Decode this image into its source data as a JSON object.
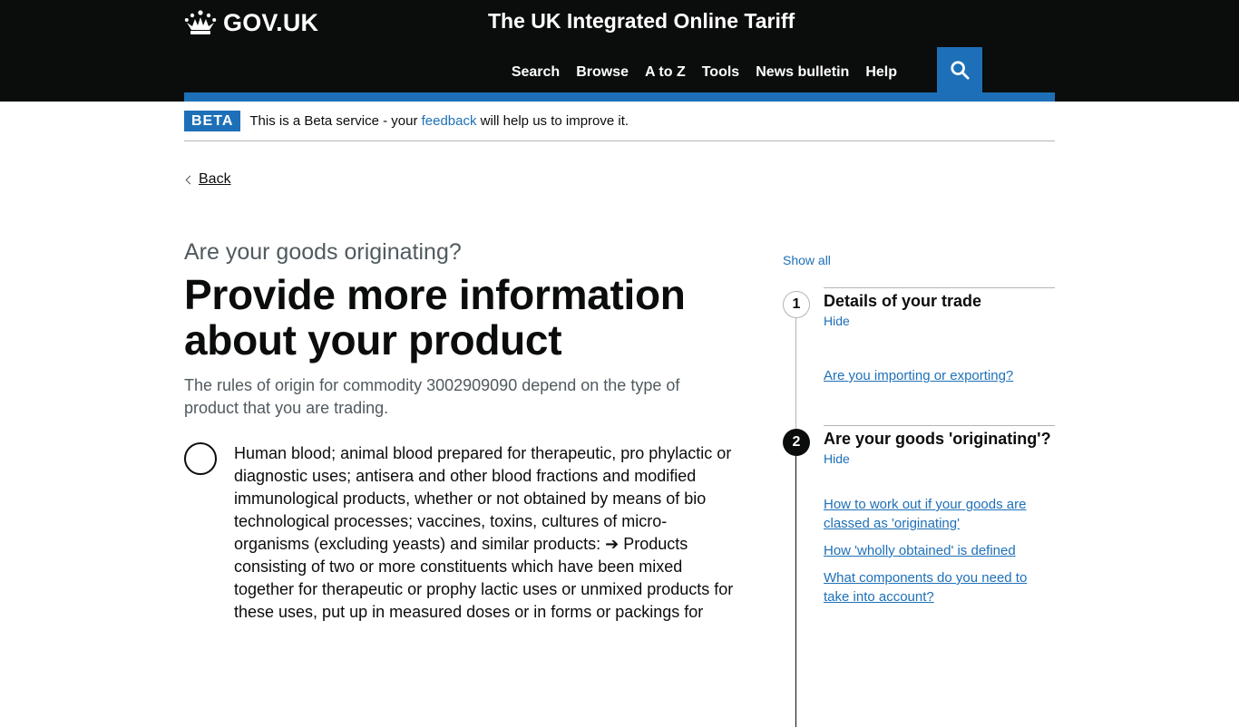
{
  "header": {
    "logo_text": "GOV.UK",
    "service_name": "The UK Integrated Online Tariff",
    "nav": [
      "Search",
      "Browse",
      "A to Z",
      "Tools",
      "News bulletin",
      "Help"
    ]
  },
  "phase_banner": {
    "tag": "BETA",
    "text_before": "This is a Beta service - your ",
    "link": "feedback",
    "text_after": " will help us to improve it."
  },
  "back_link": "Back",
  "main": {
    "caption": "Are your goods originating?",
    "heading": "Provide more information about your product",
    "lead": "The rules of origin for commodity 3002909090 depend on the type of product that you are trading.",
    "options": [
      "Human blood; animal blood prepared for therapeutic, pro phylactic or diagnostic uses; antisera and other blood fractions and modified immunological products, whether or not obtained by means of bio technological processes; vaccines, toxins, cultures of micro-organisms (excluding yeasts) and similar products: ➔ Products consisting of two or more constituents which have been mixed together for therapeutic or prophy lactic uses or unmixed products for these uses, put up in measured doses or in forms or packings for"
    ]
  },
  "sidebar": {
    "show_all": "Show all",
    "steps": [
      {
        "number": "1",
        "title": "Details of your trade",
        "toggle": "Hide",
        "links": [
          "Are you importing or exporting?"
        ]
      },
      {
        "number": "2",
        "title": "Are your goods 'originating'?",
        "toggle": "Hide",
        "links": [
          "How to work out if your goods are classed as 'originating'",
          "How 'wholly obtained' is defined",
          "What components do you need to take into account?"
        ]
      }
    ]
  },
  "colors": {
    "header_bg": "#0b0c0c",
    "brand_blue": "#1d70b8",
    "secondary_text": "#505a5f"
  },
  "icons": [
    "crown-icon",
    "search-icon",
    "chevron-left-icon"
  ]
}
